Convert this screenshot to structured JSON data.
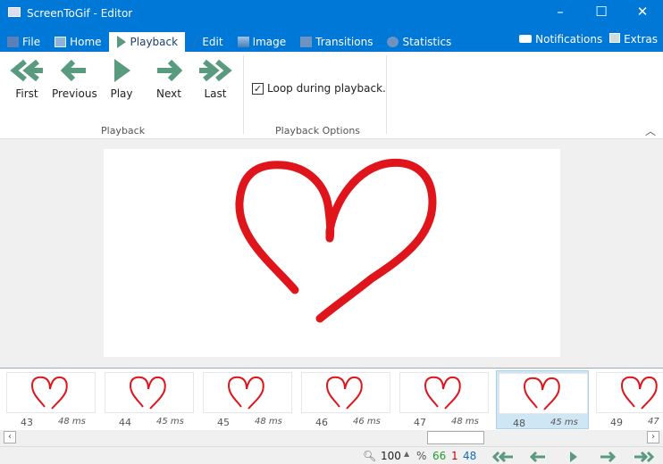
{
  "window": {
    "title": "ScreenToGif - Editor",
    "minimize": "–",
    "maximize": "☐",
    "close": "✕"
  },
  "tabs": [
    {
      "label": "File",
      "icon": "save-icon"
    },
    {
      "label": "Home",
      "icon": "home-icon"
    },
    {
      "label": "Playback",
      "icon": "play-icon",
      "active": true
    },
    {
      "label": "Edit",
      "icon": "pencil-icon"
    },
    {
      "label": "Image",
      "icon": "image-icon"
    },
    {
      "label": "Transitions",
      "icon": "transitions-icon"
    },
    {
      "label": "Statistics",
      "icon": "info-icon"
    }
  ],
  "right_tabs": {
    "notifications": "Notifications",
    "extras": "Extras"
  },
  "ribbon": {
    "buttons": [
      {
        "label": "First",
        "icon": "double-arrow-left-icon"
      },
      {
        "label": "Previous",
        "icon": "arrow-left-icon"
      },
      {
        "label": "Play",
        "icon": "play-icon"
      },
      {
        "label": "Next",
        "icon": "arrow-right-icon"
      },
      {
        "label": "Last",
        "icon": "double-arrow-right-icon"
      }
    ],
    "loop_label": "Loop during playback.",
    "loop_checked": true,
    "group_playback": "Playback",
    "group_options": "Playback Options"
  },
  "colors": {
    "accent": "#0078d7",
    "arrow": "#5a9a7e",
    "heart": "#e0141b"
  },
  "frames": [
    {
      "n": "43",
      "d": "48 ms"
    },
    {
      "n": "44",
      "d": "45 ms"
    },
    {
      "n": "45",
      "d": "48 ms"
    },
    {
      "n": "46",
      "d": "46 ms"
    },
    {
      "n": "47",
      "d": "48 ms"
    },
    {
      "n": "48",
      "d": "45 ms",
      "selected": true
    },
    {
      "n": "49",
      "d": "47"
    }
  ],
  "status": {
    "zoom": "100",
    "percent": "%",
    "total": "66",
    "selected_count": "1",
    "current": "48"
  }
}
